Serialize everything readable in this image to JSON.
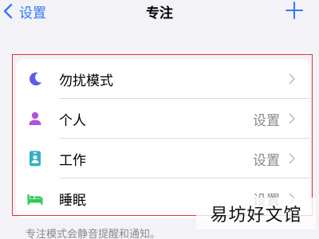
{
  "nav": {
    "back_label": "设置",
    "title": "专注"
  },
  "focus_modes": [
    {
      "label": "勿扰模式",
      "value": "",
      "icon": "moon-icon",
      "color": "#5e5ce6"
    },
    {
      "label": "个人",
      "value": "设置",
      "icon": "person-icon",
      "color": "#af52de"
    },
    {
      "label": "工作",
      "value": "设置",
      "icon": "id-badge-icon",
      "color": "#30b0c7"
    },
    {
      "label": "睡眠",
      "value": "设置",
      "icon": "bed-icon",
      "color": "#34c759"
    }
  ],
  "footer": {
    "note": "专注模式会静音提醒和通知。"
  },
  "watermark": {
    "text": "易坊好文馆"
  },
  "colors": {
    "accent": "#3478f6",
    "background": "#f2f2f7",
    "annotation": "#e0333a"
  }
}
